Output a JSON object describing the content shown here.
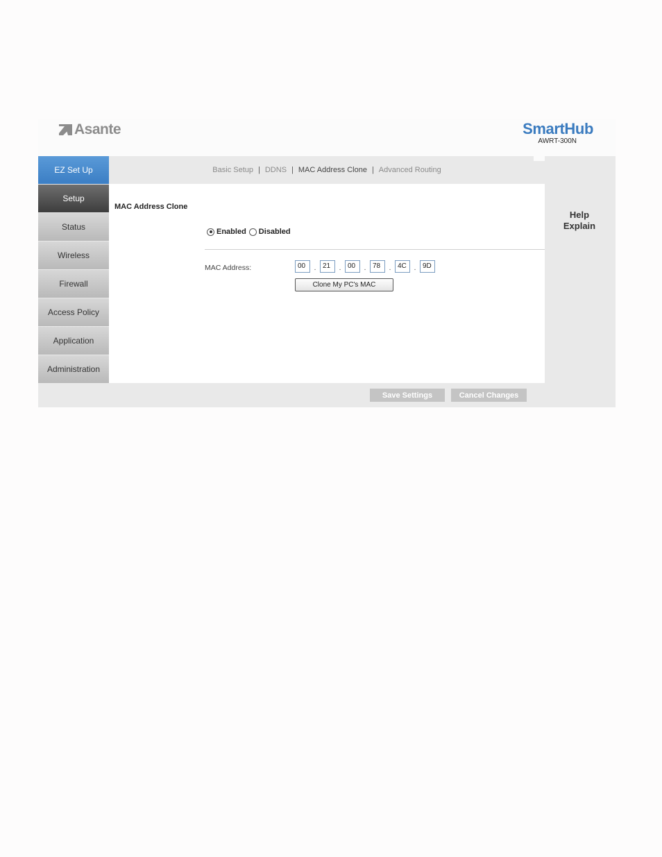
{
  "header": {
    "brand": "Asante",
    "product_title": "SmartHub",
    "product_model": "AWRT-300N"
  },
  "sidebar": {
    "items": [
      {
        "label": "EZ Set Up"
      },
      {
        "label": "Setup"
      },
      {
        "label": "Status"
      },
      {
        "label": "Wireless"
      },
      {
        "label": "Firewall"
      },
      {
        "label": "Access Policy"
      },
      {
        "label": "Application"
      },
      {
        "label": "Administration"
      }
    ]
  },
  "subnav": {
    "items": [
      {
        "label": "Basic Setup"
      },
      {
        "label": "DDNS"
      },
      {
        "label": "MAC Address Clone"
      },
      {
        "label": "Advanced Routing"
      }
    ],
    "separator": "|"
  },
  "main": {
    "section_title": "MAC Address Clone",
    "enabled_label": "Enabled",
    "disabled_label": "Disabled",
    "mac_label": "MAC Address:",
    "mac_octets": [
      "00",
      "21",
      "00",
      "78",
      "4C",
      "9D"
    ],
    "octet_separator": ".",
    "clone_button": "Clone My PC's MAC"
  },
  "help": {
    "line1": "Help",
    "line2": "Explain"
  },
  "footer": {
    "save_label": "Save Settings",
    "cancel_label": "Cancel Changes"
  },
  "colors": {
    "brand_blue": "#3a7bbf",
    "ez_setup_blue": "#4a8bcf",
    "active_nav": "#555555",
    "panel_gray": "#e9e9e9"
  }
}
